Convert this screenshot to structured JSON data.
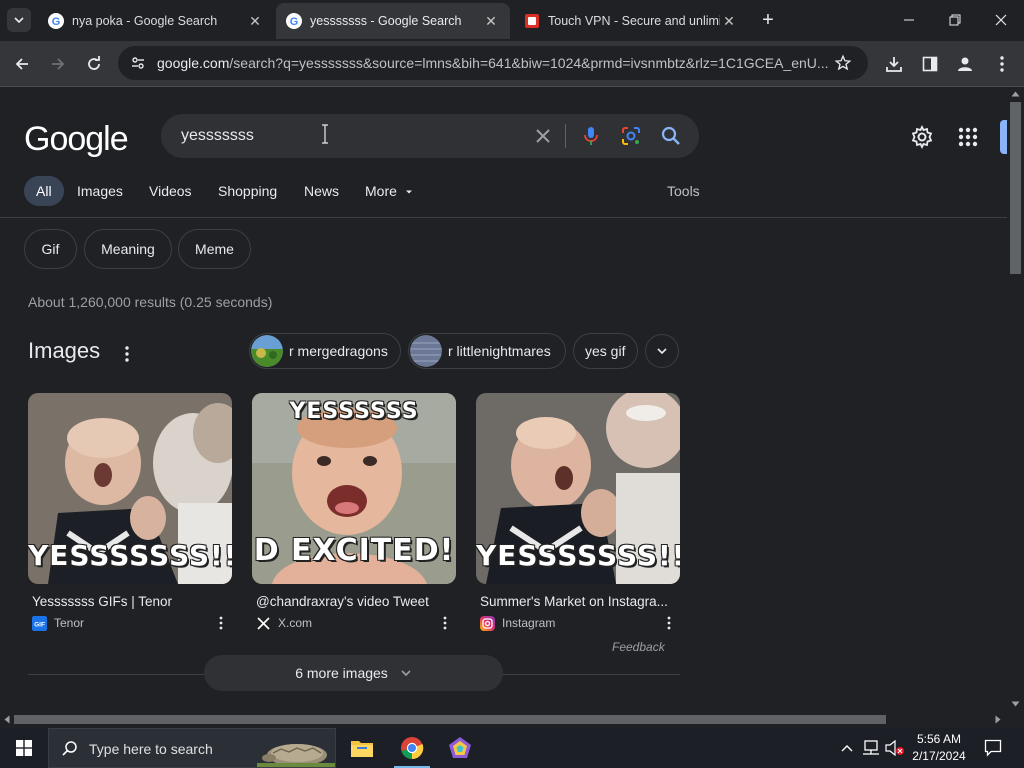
{
  "browser": {
    "tabs": [
      {
        "title": "nya poka - Google Search",
        "active": false
      },
      {
        "title": "yesssssss - Google Search",
        "active": true
      },
      {
        "title": "Touch VPN - Secure and unlimi",
        "active": false
      }
    ],
    "url_host": "google.com",
    "url_rest": "/search?q=yesssssss&source=lmns&bih=641&biw=1024&prmd=ivsnmbtz&rlz=1C1GCEA_enU..."
  },
  "google": {
    "logo": "Google",
    "query": "yesssssss",
    "nav_tabs": [
      "All",
      "Images",
      "Videos",
      "Shopping",
      "News",
      "More"
    ],
    "tools": "Tools",
    "chips": [
      "Gif",
      "Meaning",
      "Meme"
    ],
    "stats": "About 1,260,000 results (0.25 seconds)",
    "images_header": "Images",
    "pills": [
      "r mergedragons",
      "r littlenightmares",
      "yes gif"
    ],
    "image_cards": [
      {
        "overlay_text": "YESSSSSSS!!",
        "caption": "Yesssssss GIFs | Tenor",
        "source": "Tenor"
      },
      {
        "overlay_top": "YESSSSSS",
        "overlay_text": "D EXCITED!",
        "caption": "@chandraxray's video Tweet",
        "source": "X.com"
      },
      {
        "overlay_text": "YESSSSSSS!!",
        "caption": "Summer's Market on Instagra...",
        "source": "Instagram"
      }
    ],
    "feedback": "Feedback",
    "more_images": "6 more images"
  },
  "taskbar": {
    "search_placeholder": "Type here to search",
    "time": "5:56 AM",
    "date": "2/17/2024"
  },
  "colors": {
    "background": "#202124",
    "accent_blue": "#8ab4f8",
    "active_tab": "#394457"
  }
}
